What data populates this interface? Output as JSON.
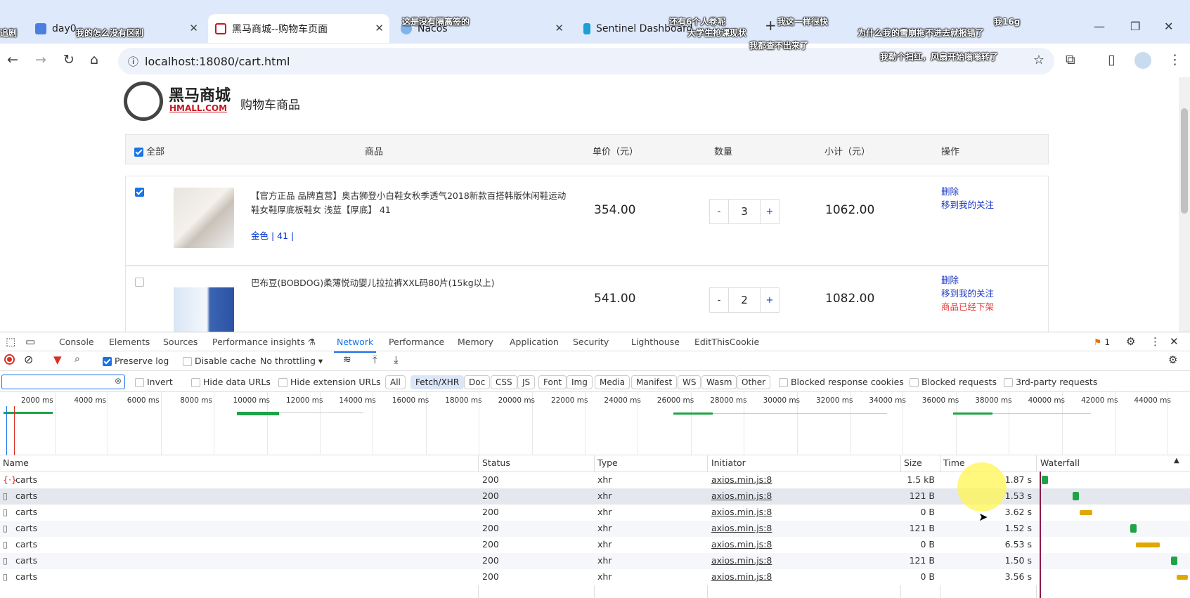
{
  "browser": {
    "tabs": [
      {
        "title": "day0",
        "icon": "doc-icon"
      },
      {
        "title": "黑马商城--购物车页面",
        "icon": "shop-icon",
        "active": true
      },
      {
        "title": "Nacos",
        "icon": "nacos-icon"
      },
      {
        "title": "Sentinel Dashboard",
        "icon": "sentinel-icon"
      }
    ],
    "new_tab": "+",
    "url": "localhost:18080/cart.html"
  },
  "danmaku": [
    {
      "text": "我的怎么没有区别"
    },
    {
      "text": "这是没有隔离签的"
    },
    {
      "text": "还有6个人卷呢"
    },
    {
      "text": "大学生抢课现状"
    },
    {
      "text": "我这一样很快"
    },
    {
      "text": "我都查不出来了"
    },
    {
      "text": "我16g"
    },
    {
      "text": "为什么我的雪崩拖不进去就报错了"
    },
    {
      "text": "我勒个扫红，风扇开始嗡嗡转了"
    },
    {
      "text": "追剧"
    }
  ],
  "page": {
    "brand_cn": "黑马商城",
    "brand_en": "HMALL.COM",
    "title": "购物车商品",
    "header": {
      "all": "全部",
      "product": "商品",
      "price": "单价（元）",
      "qty": "数量",
      "subtotal": "小计（元）",
      "ops": "操作"
    },
    "items": [
      {
        "checked": true,
        "name": "【官方正品 品牌直营】奥古狮登小白鞋女秋季透气2018新款百搭韩版休闲鞋运动鞋女鞋厚底板鞋女 浅蓝【厚底】 41",
        "attrs": "金色 | 41 |",
        "price": "354.00",
        "qty": "3",
        "subtotal": "1062.00",
        "op_delete": "删除",
        "op_follow": "移到我的关注",
        "status": ""
      },
      {
        "checked": false,
        "name": "巴布豆(BOBDOG)柔薄悦动婴儿拉拉裤XXL码80片(15kg以上)",
        "attrs": "",
        "price": "541.00",
        "qty": "2",
        "subtotal": "1082.00",
        "op_delete": "删除",
        "op_follow": "移到我的关注",
        "status": "商品已经下架"
      }
    ],
    "qty_minus": "-",
    "qty_plus": "+"
  },
  "devtools": {
    "tabs": [
      "Console",
      "Elements",
      "Sources",
      "Performance insights ⚗",
      "Network",
      "Performance",
      "Memory",
      "Application",
      "Security",
      "Lighthouse",
      "EditThisCookie"
    ],
    "active_tab": "Network",
    "issues_count": "1",
    "preserve_log": "Preserve log",
    "disable_cache": "Disable cache",
    "throttling": "No throttling",
    "filter_placeholder": "",
    "invert": "Invert",
    "hide_data_urls": "Hide data URLs",
    "hide_ext_urls": "Hide extension URLs",
    "type_filters": [
      "All",
      "Fetch/XHR",
      "Doc",
      "CSS",
      "JS",
      "Font",
      "Img",
      "Media",
      "Manifest",
      "WS",
      "Wasm",
      "Other"
    ],
    "active_filter": "Fetch/XHR",
    "blocked_cookies": "Blocked response cookies",
    "blocked_requests": "Blocked requests",
    "third_party": "3rd-party requests",
    "timeline_ticks": [
      "2000 ms",
      "4000 ms",
      "6000 ms",
      "8000 ms",
      "10000 ms",
      "12000 ms",
      "14000 ms",
      "16000 ms",
      "18000 ms",
      "20000 ms",
      "22000 ms",
      "24000 ms",
      "26000 ms",
      "28000 ms",
      "30000 ms",
      "32000 ms",
      "34000 ms",
      "36000 ms",
      "38000 ms",
      "40000 ms",
      "42000 ms",
      "44000 ms"
    ],
    "columns": [
      "Name",
      "Status",
      "Type",
      "Initiator",
      "Size",
      "Time",
      "Waterfall"
    ],
    "requests": [
      {
        "name": "carts",
        "status": "200",
        "type": "xhr",
        "initiator": "axios.min.js:8",
        "size": "1.5 kB",
        "time": "1.87 s",
        "color": "#1ea446"
      },
      {
        "name": "carts",
        "status": "200",
        "type": "xhr",
        "initiator": "axios.min.js:8",
        "size": "121 B",
        "time": "1.53 s",
        "color": "#1ea446"
      },
      {
        "name": "carts",
        "status": "200",
        "type": "xhr",
        "initiator": "axios.min.js:8",
        "size": "0 B",
        "time": "3.62 s",
        "color": "#e0a800"
      },
      {
        "name": "carts",
        "status": "200",
        "type": "xhr",
        "initiator": "axios.min.js:8",
        "size": "121 B",
        "time": "1.52 s",
        "color": "#1ea446"
      },
      {
        "name": "carts",
        "status": "200",
        "type": "xhr",
        "initiator": "axios.min.js:8",
        "size": "0 B",
        "time": "6.53 s",
        "color": "#e0a800"
      },
      {
        "name": "carts",
        "status": "200",
        "type": "xhr",
        "initiator": "axios.min.js:8",
        "size": "121 B",
        "time": "1.50 s",
        "color": "#1ea446"
      },
      {
        "name": "carts",
        "status": "200",
        "type": "xhr",
        "initiator": "axios.min.js:8",
        "size": "0 B",
        "time": "3.56 s",
        "color": "#e0a800"
      }
    ]
  }
}
